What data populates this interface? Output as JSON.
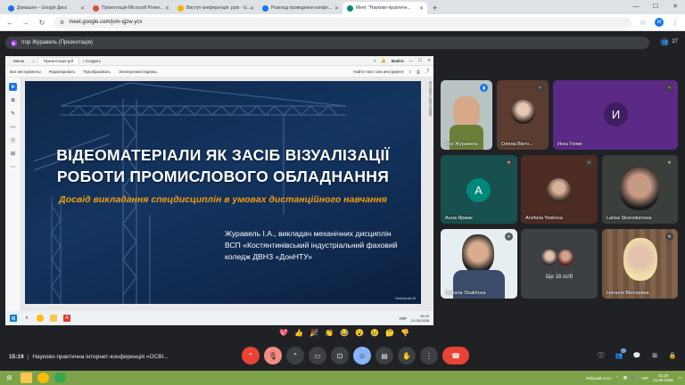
{
  "browser": {
    "tabs": [
      {
        "title": "Домашня – Google Диск",
        "color": "#1a73e8"
      },
      {
        "title": "Презентація Microsoft Power...",
        "color": "#d35230"
      },
      {
        "title": "Виступ конференція .pptx - G...",
        "color": "#f4b400"
      },
      {
        "title": "Розклад проведення конфе...",
        "color": "#1a73e8"
      },
      {
        "title": "Meet: \"Науково-практичн...",
        "color": "#00897b"
      }
    ],
    "new_tab": "+",
    "url": "meet.google.com/jvm-qjzw-ycv",
    "profile_initial": "М"
  },
  "meet": {
    "presenter_label": "Ігор Журавель (Презентація)",
    "people_count": "27",
    "meeting_time": "15:19",
    "meeting_title": "Науково-практична інтернет-конференція «ОСВІ...",
    "participants": [
      {
        "name": "Ігор Журавель",
        "type": "video"
      },
      {
        "name": "Олена Вікто...",
        "type": "photo"
      },
      {
        "name": "Инга Голик",
        "type": "avatar",
        "initial": "И",
        "color": "#7e3bb0"
      },
      {
        "name": "Анна Ярмак",
        "type": "avatar",
        "initial": "А",
        "color": "#00897b"
      },
      {
        "name": "Anzhela Yeskova",
        "type": "photo"
      },
      {
        "name": "Larisa Skorodumova",
        "type": "video"
      },
      {
        "name": "Svitlana Shakhova",
        "type": "video"
      },
      {
        "name": "Ще 18 осіб",
        "type": "more"
      },
      {
        "name": "Наталія Вікторівна",
        "type": "video"
      }
    ],
    "reactions": [
      "💖",
      "👍",
      "🎉",
      "👏",
      "😂",
      "😮",
      "😢",
      "🤔",
      "👎"
    ]
  },
  "pdf": {
    "menu_label": "Меню",
    "tab_label": "Презентація.pdf",
    "create_label": "Создать",
    "signin_label": "Войти",
    "toolbar": [
      "Все инструменты",
      "Редактировать",
      "Преобразовать",
      "Электронная подпись"
    ],
    "find_label": "Найти текст или инструмент"
  },
  "slide": {
    "title_line1": "ВІДЕОМАТЕРІАЛИ ЯК ЗАСІБ ВІЗУАЛІЗАЦІЇ",
    "title_line2": "РОБОТИ ПРОМИСЛОВОГО ОБЛАДНАННЯ",
    "subtitle": "Досвід викладання спецдисциплін в умовах дистанційного навчання",
    "author_line1": "Журавель І.А., викладач механічних дисциплін",
    "author_line2": "ВСП «Костянтинівський індустріальний фаховий",
    "author_line3": "коледж ДВНЗ «ДонНТУ»",
    "watermark": "NotebookLM"
  },
  "inner_taskbar": {
    "lang": "УКР",
    "time": "15:19",
    "date": "21.05.2026"
  },
  "taskbar": {
    "desktop_label": "Рабочий стол",
    "lang": "УКР",
    "time": "15:19",
    "date": "21.05.2026"
  }
}
